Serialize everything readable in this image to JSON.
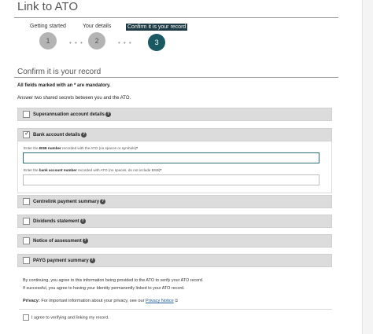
{
  "page": {
    "title": "Link to ATO"
  },
  "steps": [
    {
      "label": "Getting started",
      "number": "1",
      "state": "done"
    },
    {
      "label": "Your details",
      "number": "2",
      "state": "done"
    },
    {
      "label": "Confirm it is your record",
      "number": "3",
      "state": "active"
    }
  ],
  "section": {
    "title": "Confirm it is your record",
    "mandatory": "All fields marked with an * are mandatory.",
    "instruction": "Answer two shared secrets between you and the ATO."
  },
  "accordions": [
    {
      "label": "Superannuation account details",
      "checked": false
    },
    {
      "label": "Bank account details",
      "checked": true
    },
    {
      "label": "Centrelink payment summary",
      "checked": false
    },
    {
      "label": "Dividends statement",
      "checked": false
    },
    {
      "label": "Notice of assessment",
      "checked": false
    },
    {
      "label": "PAYG payment summary",
      "checked": false
    }
  ],
  "bank_fields": {
    "bsb": {
      "pre": "Enter the ",
      "bold": "BSB number",
      "post": " recorded with the ATO (no spaces or symbols)",
      "required_mark": "*",
      "value": ""
    },
    "account": {
      "pre": "Enter the ",
      "bold": "bank account number",
      "post": " recorded with ATO (no spaces, do not include BSB)",
      "required_mark": "*",
      "value": ""
    }
  },
  "consent": {
    "line1": "By continuing, you agree to this information being provided to the ATO to verify your ATO record.",
    "line2": "If successful, you agree to having your Identity permanently linked to your ATO record.",
    "privacy_label": "Privacy:",
    "privacy_text": " For important information about your privacy, see our ",
    "privacy_link": "Privacy Notice",
    "agree_label": "I agree to verifying and linking my record."
  },
  "colors": {
    "accent": "#1a5862",
    "step_active_label_bg": "#1d3b45",
    "accordion_bg": "#dcdcdc",
    "link": "#1f5a9a"
  },
  "icons": {
    "help": "question-circle-icon",
    "check": "checkmark-icon",
    "external": "external-link-icon"
  }
}
